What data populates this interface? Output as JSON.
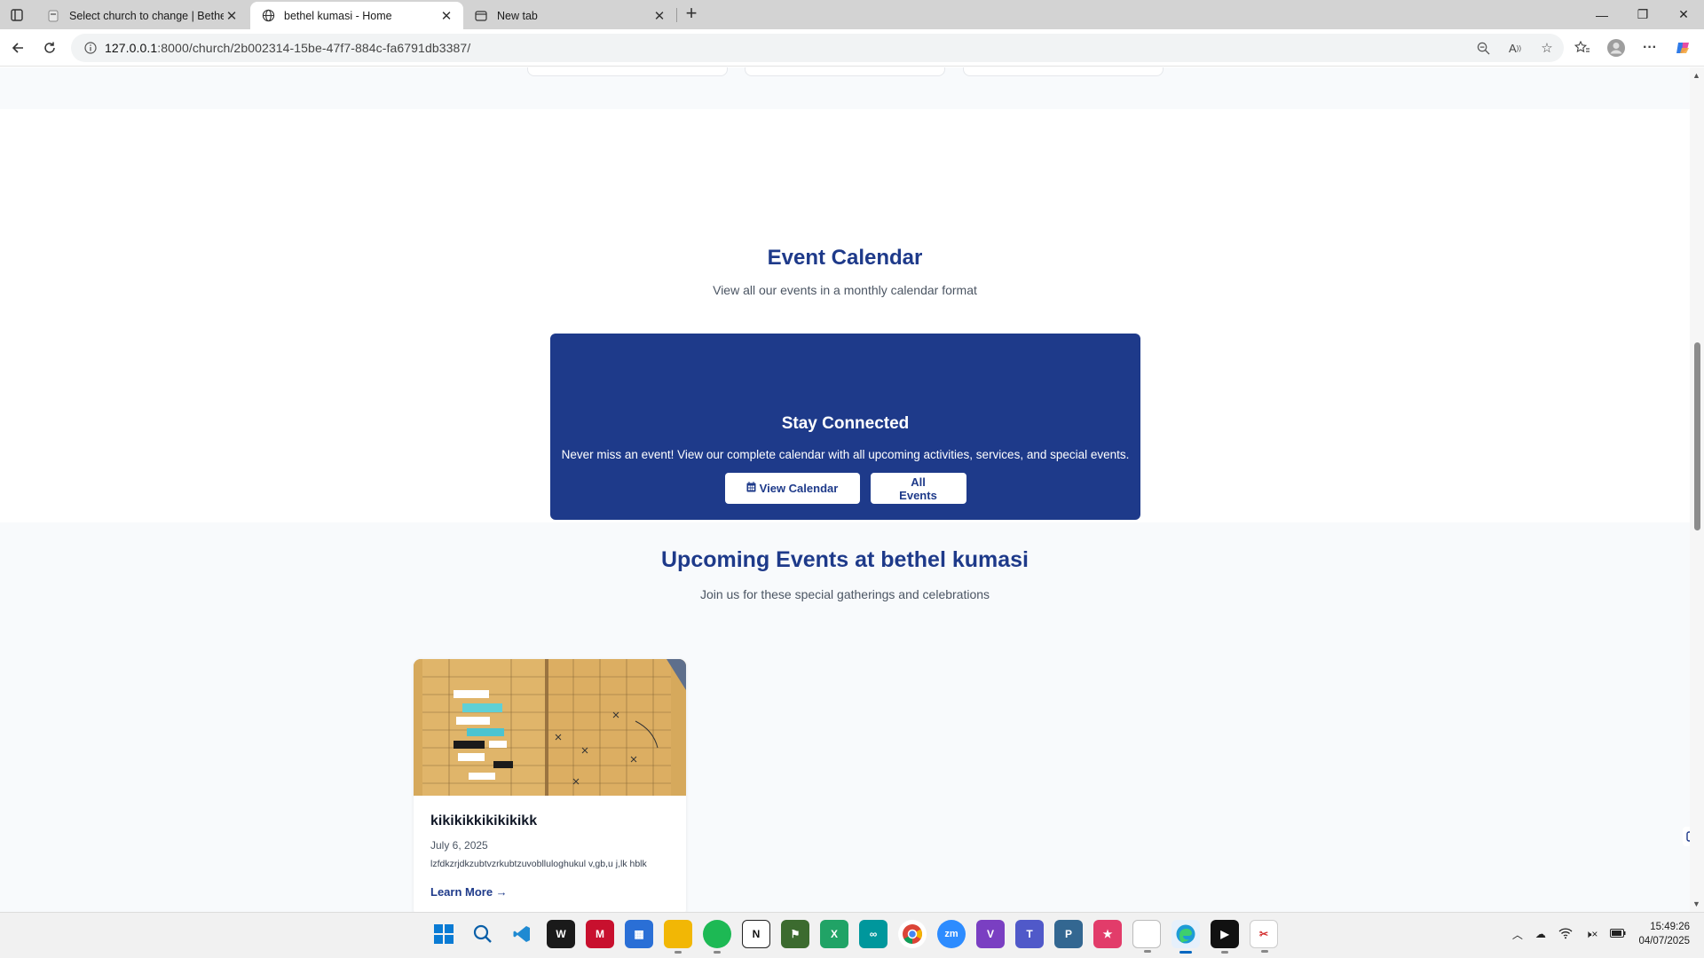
{
  "browser": {
    "tabs": [
      {
        "title": "Select church to change | Bethel F",
        "active": false
      },
      {
        "title": "bethel kumasi - Home",
        "active": true
      },
      {
        "title": "New tab",
        "active": false
      }
    ],
    "url_host": "127.0.0.1",
    "url_rest": ":8000/church/2b002314-15be-47f7-884c-fa6791db3387/"
  },
  "calendar_section": {
    "title": "Event Calendar",
    "subtitle": "View all our events in a monthly calendar format",
    "card": {
      "title": "Stay Connected",
      "text": "Never miss an event! View our complete calendar with all upcoming activities, services, and special events.",
      "view_calendar_label": "View Calendar",
      "all_events_label": "All Events"
    }
  },
  "events_section": {
    "title": "Upcoming Events at bethel kumasi",
    "subtitle": "Join us for these special gatherings and celebrations",
    "events": [
      {
        "title": "kikikikkikikikikk",
        "date": "July 6, 2025",
        "description": "lzfdkzrjdkzubtvzrkubtzuvoblluloghukul v,gb,u j,lk hblk",
        "link_label": "Learn More →"
      }
    ]
  },
  "taskbar": {
    "time": "15:49:26",
    "date": "04/07/2025"
  },
  "colors": {
    "brand_navy": "#1e3a8a",
    "page_alt_bg": "#f8fafc"
  }
}
